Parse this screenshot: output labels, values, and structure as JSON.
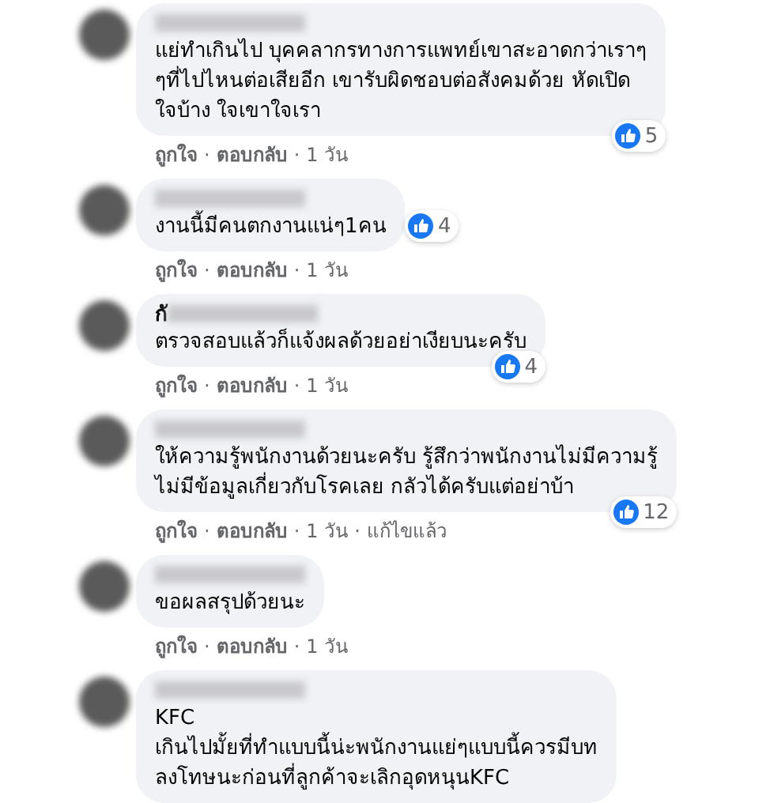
{
  "separator": "·",
  "comments": [
    {
      "lines": [
        "แย่ทำเกินไป บุคคลากรทางการแพทย์เขาสะอาดกว่าเราๆ",
        "ๆที่ไปไหนต่อเสียอีก เขารับผิดชอบต่อสังคมด้วย หัดเปิด",
        "ใจบ้าง ใจเขาใจเรา"
      ],
      "likes": "5",
      "actions": [
        "ถูกใจ",
        "ตอบกลับ"
      ],
      "time": "1 วัน"
    },
    {
      "lines": [
        "งานนี้มีคนตกงานแน่ๆ1คน"
      ],
      "likes": "4",
      "reaction_inline": true,
      "actions": [
        "ถูกใจ",
        "ตอบกลับ"
      ],
      "time": "1 วัน"
    },
    {
      "name_prefix": "กั",
      "lines": [
        "ตรวจสอบแล้วก็แจ้งผลด้วยอย่าเงียบนะครับ"
      ],
      "likes": "4",
      "actions": [
        "ถูกใจ",
        "ตอบกลับ"
      ],
      "time": "1 วัน"
    },
    {
      "lines": [
        "ให้ความรู้พนักงานด้วยนะครับ รู้สึกว่าพนักงานไม่มีความรู้",
        "ไม่มีข้อมูลเกี่ยวกับโรคเลย กลัวได้ครับแต่อย่าบ้า"
      ],
      "likes": "12",
      "actions": [
        "ถูกใจ",
        "ตอบกลับ"
      ],
      "time": "1 วัน",
      "edited": "แก้ไขแล้ว"
    },
    {
      "lines": [
        "ขอผลสรุปด้วยนะ"
      ],
      "actions": [
        "ถูกใจ",
        "ตอบกลับ"
      ],
      "time": "1 วัน"
    },
    {
      "lines": [
        "KFC",
        "เกินไปมั้ยที่ทำแบบนี้น่ะพนักงานแย่ๆแบบนี้ควรมีบท",
        "ลงโทษนะก่อนที่ลูกค้าจะเลิกอุดหนุนKFC"
      ]
    }
  ]
}
